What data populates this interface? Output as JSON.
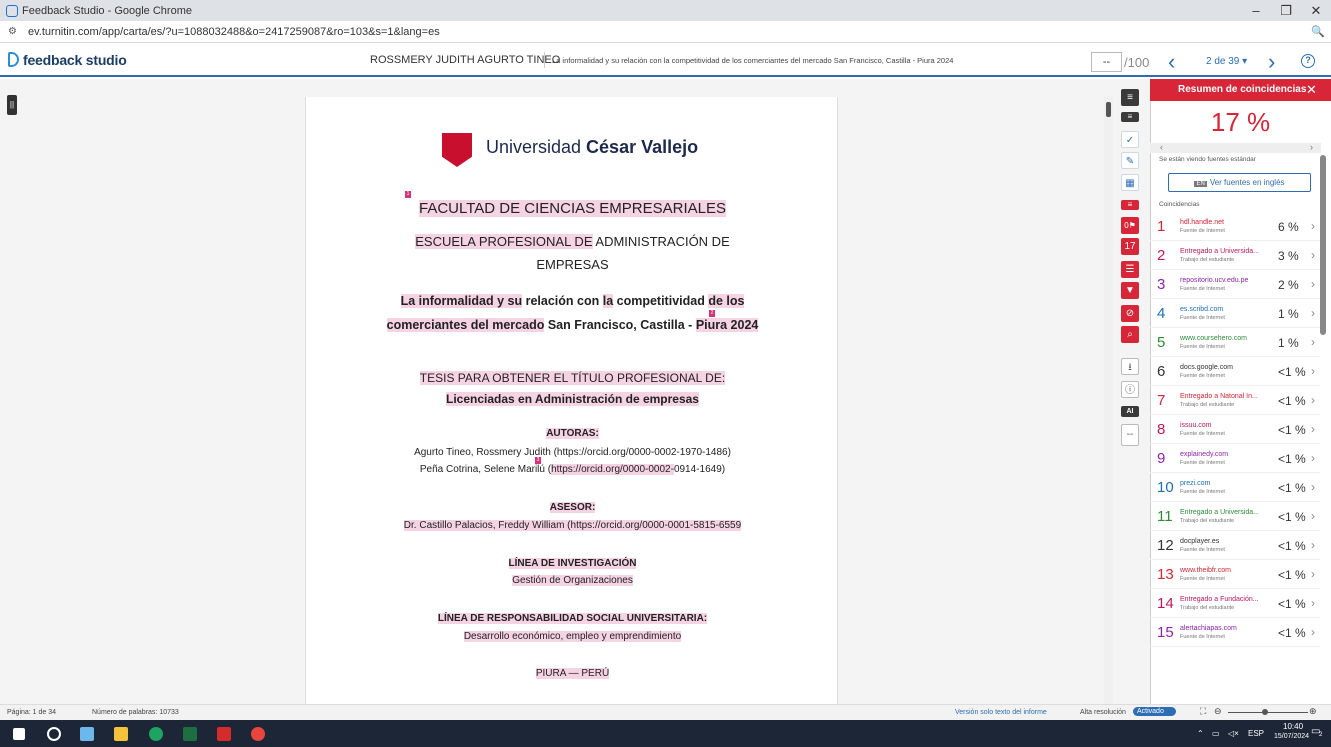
{
  "browser": {
    "window_title": "Feedback Studio - Google Chrome",
    "url": "ev.turnitin.com/app/carta/es/?u=1088032488&o=2417259087&ro=103&s=1&lang=es",
    "minimize": "–",
    "maximize": "❐",
    "close": "✕",
    "zoom_icon": "🔍"
  },
  "header": {
    "logo_text": "feedback studio",
    "author": "ROSSMERY JUDITH AGURTO TINEO",
    "title": "La informalidad y su relación con la competitividad de los comerciantes del mercado San Francisco, Castilla - Piura 2024",
    "grade_value": "--",
    "grade_total": "/100",
    "page_label": "2 de 39 ▾",
    "prev": "‹",
    "next": "›",
    "help": "?"
  },
  "document": {
    "university_name_light": "Universidad ",
    "university_name_bold": "César Vallejo",
    "faculty": "FACULTAD DE CIENCIAS EMPRESARIALES",
    "school_line1_hl": "ESCUELA PROFESIONAL DE",
    "school_line1_rest": " ADMINISTRACIÓN DE",
    "school_line2": "EMPRESAS",
    "thesis_title_l1a": "La informalidad y su",
    "thesis_title_l1b": " relación con ",
    "thesis_title_l1c": "la",
    "thesis_title_l1d": " competitividad ",
    "thesis_title_l1e": "de los",
    "thesis_title_l2a": "comerciantes del mercado",
    "thesis_title_l2b": " San Francisco, Castilla - ",
    "thesis_title_l2c": "Piura 2024",
    "thesis_for": "TESIS PARA OBTENER EL TÍTULO PROFESIONAL DE:",
    "degree": "Licenciadas en Administración de empresas",
    "authors_label": "AUTORAS:",
    "author1": "Agurto Tineo, Rossmery Judith (https://orcid.org/0000-0002-1970-1486)",
    "author2_a": "Peña Cotrina, Selene Marilú (",
    "author2_b": "https://orcid.org/0000-0002-",
    "author2_c": "0914-1649)",
    "advisor_label": "ASESOR:",
    "advisor": "Dr. Castillo Palacios, Freddy William (https://orcid.org/0000-0001-5815-6559",
    "research_line_label": "LÍNEA DE INVESTIGACIÓN",
    "research_line": "Gestión de Organizaciones",
    "rsu_label": "LÍNEA DE RESPONSABILIDAD SOCIAL UNIVERSITARIA:",
    "rsu": "Desarrollo económico, empleo y emprendimiento",
    "place": "PIURA — PERÚ",
    "badge1": "1",
    "badge2": "2",
    "badge3": "3"
  },
  "tools": {
    "layers": "≡",
    "rubric": "✓",
    "edit": "✎",
    "grid": "▦",
    "flag_count": "0⚑",
    "match_count": "17",
    "filter": "▼",
    "exclude": "⊘",
    "search": "⌕",
    "download": "⭳",
    "info": "ⓘ",
    "ai_label": "AI",
    "ai_value": "--"
  },
  "panel": {
    "title": "Resumen de coincidencias",
    "close": "✕",
    "similarity": "17 %",
    "note": "Se están viendo fuentes estándar",
    "button_en": "EN",
    "button_label": "Ver fuentes en inglés",
    "section": "Coincidencias",
    "matches": [
      {
        "n": "1",
        "source": "hdl.handle.net",
        "type": "Fuente de Internet",
        "pct": "6 %",
        "color": "#d72638"
      },
      {
        "n": "2",
        "source": "Entregado a Universida...",
        "type": "Trabajo del estudiante",
        "pct": "3 %",
        "color": "#c2185b"
      },
      {
        "n": "3",
        "source": "repositorio.ucv.edu.pe",
        "type": "Fuente de Internet",
        "pct": "2 %",
        "color": "#8e24aa"
      },
      {
        "n": "4",
        "source": "es.scribd.com",
        "type": "Fuente de Internet",
        "pct": "1 %",
        "color": "#1e6fb8"
      },
      {
        "n": "5",
        "source": "www.coursehero.com",
        "type": "Fuente de Internet",
        "pct": "1 %",
        "color": "#2e8b3c"
      },
      {
        "n": "6",
        "source": "docs.google.com",
        "type": "Fuente de Internet",
        "pct": "<1 %",
        "color": "#333333"
      },
      {
        "n": "7",
        "source": "Entregado a Natonal In...",
        "type": "Trabajo del estudiante",
        "pct": "<1 %",
        "color": "#d72638"
      },
      {
        "n": "8",
        "source": "issuu.com",
        "type": "Fuente de Internet",
        "pct": "<1 %",
        "color": "#c2185b"
      },
      {
        "n": "9",
        "source": "explainedy.com",
        "type": "Fuente de Internet",
        "pct": "<1 %",
        "color": "#8e24aa"
      },
      {
        "n": "10",
        "source": "prezi.com",
        "type": "Fuente de Internet",
        "pct": "<1 %",
        "color": "#1e6fb8"
      },
      {
        "n": "11",
        "source": "Entregado a Universida...",
        "type": "Trabajo del estudiante",
        "pct": "<1 %",
        "color": "#2e8b3c"
      },
      {
        "n": "12",
        "source": "docplayer.es",
        "type": "Fuente de Internet",
        "pct": "<1 %",
        "color": "#333333"
      },
      {
        "n": "13",
        "source": "www.theibfr.com",
        "type": "Fuente de Internet",
        "pct": "<1 %",
        "color": "#d72638"
      },
      {
        "n": "14",
        "source": "Entregado a Fundación...",
        "type": "Trabajo del estudiante",
        "pct": "<1 %",
        "color": "#c2185b"
      },
      {
        "n": "15",
        "source": "alertachiapas.com",
        "type": "Fuente de Internet",
        "pct": "<1 %",
        "color": "#8e24aa"
      }
    ]
  },
  "status": {
    "page": "Página: 1 de 34",
    "words": "Número de palabras: 10733",
    "text_only": "Versión solo texto del informe",
    "hires": "Alta resolución",
    "toggle": "Activado"
  },
  "taskbar": {
    "lang": "ESP",
    "time": "10:40",
    "date": "15/07/2024",
    "notif": "2"
  }
}
